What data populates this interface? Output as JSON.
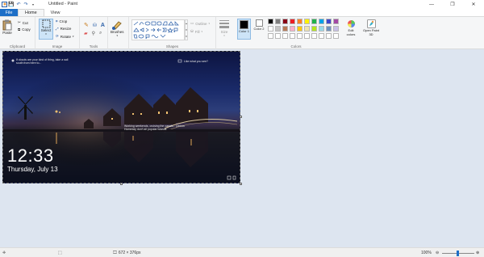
{
  "window": {
    "title": "Untitled - Paint"
  },
  "tabs": [
    {
      "label": "File"
    },
    {
      "label": "Home"
    },
    {
      "label": "View"
    }
  ],
  "ribbon": {
    "clipboard": {
      "group": "Clipboard",
      "paste": "Paste",
      "cut": "Cut",
      "copy": "Copy"
    },
    "image": {
      "group": "Image",
      "select": "Select",
      "crop": "Crop",
      "resize": "Resize",
      "rotate": "Rotate"
    },
    "tools": {
      "group": "Tools"
    },
    "brushes": {
      "label": "Brushes"
    },
    "shapes": {
      "group": "Shapes",
      "outline": "Outline",
      "fill": "Fill"
    },
    "size": {
      "label": "Size"
    },
    "colors": {
      "group": "Colors",
      "color1": "Color 1",
      "color2": "Color 2",
      "edit": "Edit colors",
      "paint3d": "Open Paint 3D",
      "palette": [
        "#000000",
        "#7f7f7f",
        "#880015",
        "#ed1c24",
        "#ff7f27",
        "#fff200",
        "#22b14c",
        "#00a2e8",
        "#3f48cc",
        "#a349a4",
        "#ffffff",
        "#c3c3c3",
        "#b97a57",
        "#ffaec9",
        "#ffc90e",
        "#efe4b0",
        "#b5e61d",
        "#99d9ea",
        "#7092be",
        "#c8bfe7"
      ]
    }
  },
  "canvas": {
    "lockscreen": {
      "time": "12:33",
      "date": "Thursday, July 13",
      "hint_left": "If clouds are your kind of thing, take a sail south from here to...",
      "hint_right": "Like what you see?",
      "hint_mid": "Working weekends, cruising the canals... partner Homeday don't all popular islands"
    }
  },
  "status": {
    "dimensions": "672 × 376px",
    "zoom": "100%"
  }
}
